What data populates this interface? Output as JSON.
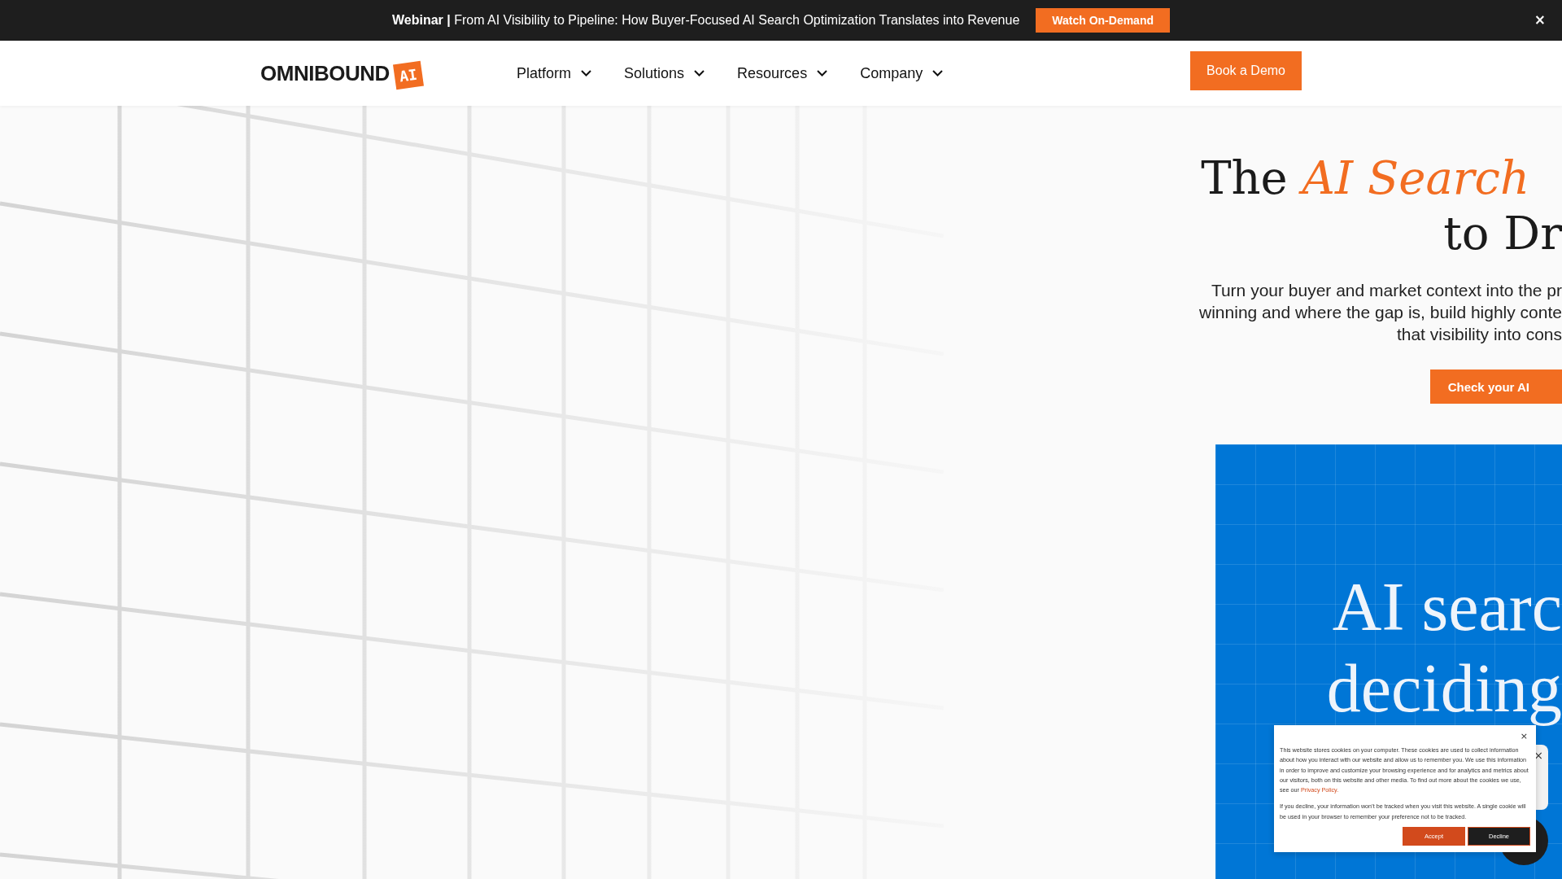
{
  "announcement": {
    "text": "**Webinar |** From AI Visibility to Pipeline: How Buyer-Focused AI Search Optimization Translates into Revenue",
    "button": "Watch On-Demand",
    "close": "×"
  },
  "logo": {
    "word": "OMNIBOUND",
    "badge": "AI"
  },
  "nav": [
    {
      "label": "Platform"
    },
    {
      "label": "Solutions"
    },
    {
      "label": "Resources"
    },
    {
      "label": "Company"
    }
  ],
  "cta": "Book a Demo",
  "hero": {
    "title_lines": [
      "The *AI Search*",
      "to Dr"
    ],
    "subtitle_lines": [
      "Turn your buyer and market context into the pr",
      "winning and where the gap is, build highly conte",
      "that visibility into cons"
    ],
    "button": "Check your AI"
  },
  "panel": {
    "lines": [
      "AI searc",
      "deciding"
    ]
  },
  "chat": {
    "close": "×"
  },
  "cookie": {
    "close": "×",
    "paragraphs": [
      {
        "text": "This website stores cookies on your computer. These cookies are used to collect information about how you interact with our website and allow us to remember you. We use this information in order to improve and customize your browsing experience and for analytics and metrics about our visitors, both on this website and other media. To find out more about the cookies we use, see our ",
        "link": "Privacy Policy."
      },
      {
        "text": "If you decline, your information won’t be tracked when you visit this website. A single cookie will be used in your browser to remember your preference not to be tracked."
      }
    ],
    "buttons": [
      {
        "kind": "accept",
        "label": "Accept"
      },
      {
        "kind": "decline",
        "label": "Decline"
      }
    ]
  }
}
